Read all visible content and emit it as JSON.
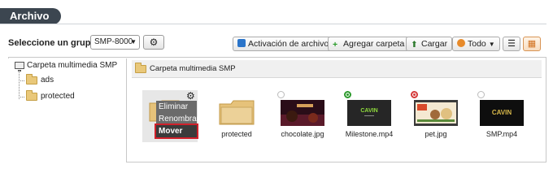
{
  "title": "Archivo",
  "group": {
    "label": "Seleccione un grupo:",
    "selected": "SMP-8000"
  },
  "toolbar": {
    "activation": "Activación de archivo",
    "add_folder": "Agregar carpeta",
    "upload": "Cargar",
    "filter": "Todo"
  },
  "tree": {
    "root": "Carpeta multimedia SMP",
    "items": [
      "ads",
      "protected"
    ]
  },
  "breadcrumb": "Carpeta multimedia SMP",
  "items": [
    {
      "label": ""
    },
    {
      "label": "protected"
    },
    {
      "label": "chocolate.jpg"
    },
    {
      "label": "Milestone.mp4"
    },
    {
      "label": "pet.jpg"
    },
    {
      "label": "SMP.mp4"
    }
  ],
  "context_menu": [
    "Eliminar",
    "Renombrar",
    "Mover"
  ],
  "colors": {
    "accent": "#3c4650",
    "highlight": "#d0202a"
  }
}
